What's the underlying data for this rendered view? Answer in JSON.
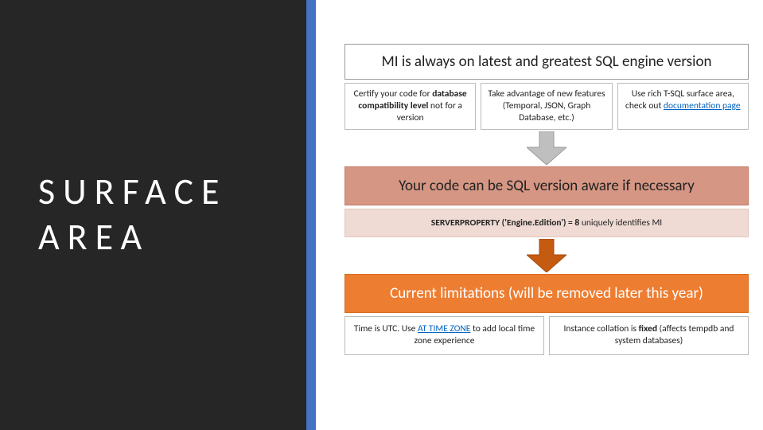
{
  "sidebar": {
    "title_line1": "SURFACE",
    "title_line2": "AREA"
  },
  "colors": {
    "sidebar_bg": "#262626",
    "accent": "#4472C4",
    "mid_header_bg": "#D59683",
    "mid_sub_bg": "#F0DBD4",
    "bottom_header_bg": "#ED7D31",
    "link": "#0563C1",
    "arrow": "#BFBFBF"
  },
  "section1": {
    "header": "MI is always on latest and greatest SQL engine version",
    "cells": [
      {
        "pre": "Certify your code for ",
        "bold": "database compatibility level",
        "post": " not for a version"
      },
      {
        "text": "Take advantage of new features (Temporal, JSON, Graph Database, etc.)"
      },
      {
        "pre": "Use rich T-SQL surface area, check out ",
        "link": "documentation page"
      }
    ]
  },
  "section2": {
    "header": "Your code can be SQL version aware if necessary",
    "sub_pre": "SERVERPROPERTY ('Engine.Edition') = 8",
    "sub_post": " uniquely identifies MI"
  },
  "section3": {
    "header": "Current limitations (will be removed later this year)",
    "cells": [
      {
        "pre": "Time is UTC. Use ",
        "link": "AT TIME ZONE",
        "post": " to add local time zone experience"
      },
      {
        "pre": "Instance collation is ",
        "bold": "fixed",
        "post": " (affects tempdb and system databases)"
      }
    ]
  }
}
